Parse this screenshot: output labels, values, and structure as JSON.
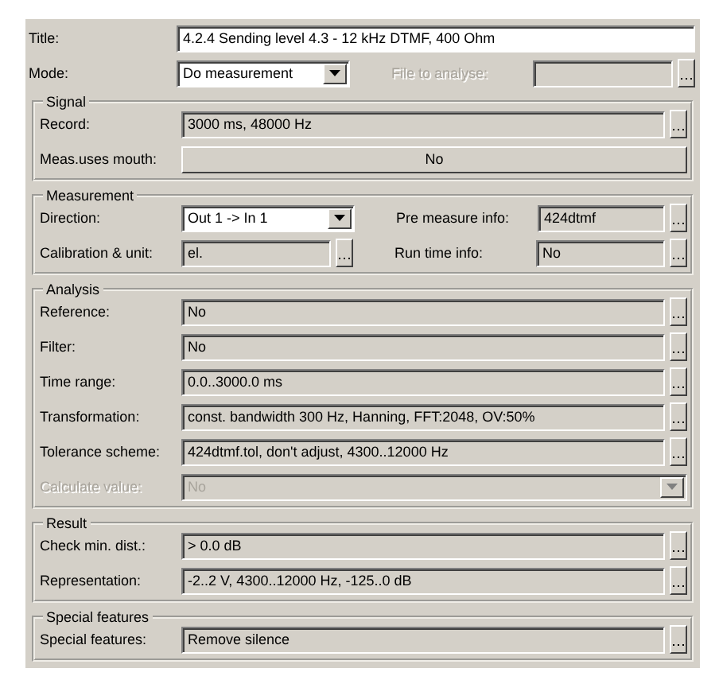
{
  "title": {
    "label": "Title:",
    "value": "4.2.4 Sending level 4.3 - 12 kHz DTMF, 400 Ohm"
  },
  "mode": {
    "label": "Mode:",
    "value": "Do measurement",
    "file_label": "File to analyse:",
    "file_disabled": true
  },
  "groups": [
    {
      "legend": "Signal",
      "rows": [
        {
          "kind": "field",
          "label": "Record:",
          "value": "3000 ms, 48000 Hz",
          "disabled": false
        },
        {
          "kind": "button",
          "label": "Meas.uses mouth:",
          "value": "No",
          "disabled": false
        }
      ]
    },
    {
      "legend": "Measurement",
      "rows": [
        {
          "kind": "pair",
          "disabled": false,
          "left": {
            "kind": "dropdown",
            "label": "Direction:",
            "value": "Out 1 -> In 1"
          },
          "right": {
            "label": "Pre measure info:",
            "value": "424dtmf"
          }
        },
        {
          "kind": "pair",
          "disabled": false,
          "left": {
            "kind": "field",
            "label": "Calibration & unit:",
            "value": "el."
          },
          "right": {
            "label": "Run time info:",
            "value": "No"
          }
        }
      ]
    },
    {
      "legend": "Analysis",
      "rows": [
        {
          "kind": "field",
          "label": "Reference:",
          "value": "No",
          "disabled": false
        },
        {
          "kind": "field",
          "label": "Filter:",
          "value": "No",
          "disabled": false
        },
        {
          "kind": "field",
          "label": "Time range:",
          "value": "0.0..3000.0 ms",
          "disabled": false
        },
        {
          "kind": "field",
          "label": "Transformation:",
          "value": "const. bandwidth 300 Hz, Hanning, FFT:2048, OV:50%",
          "disabled": false
        },
        {
          "kind": "field",
          "label": "Tolerance scheme:",
          "value": "424dtmf.tol, don't adjust, 4300..12000 Hz",
          "disabled": false
        },
        {
          "kind": "dropdown",
          "label": "Calculate value:",
          "value": "No",
          "disabled": true
        }
      ]
    },
    {
      "legend": "Result",
      "rows": [
        {
          "kind": "field",
          "label": "Check min. dist.:",
          "value": "> 0.0 dB",
          "disabled": false
        },
        {
          "kind": "field",
          "label": "Representation:",
          "value": "-2..2 V, 4300..12000 Hz, -125..0 dB",
          "disabled": false
        }
      ]
    },
    {
      "legend": "Special features",
      "rows": [
        {
          "kind": "field",
          "label": "Special features:",
          "value": "Remove silence",
          "disabled": false
        }
      ]
    }
  ]
}
